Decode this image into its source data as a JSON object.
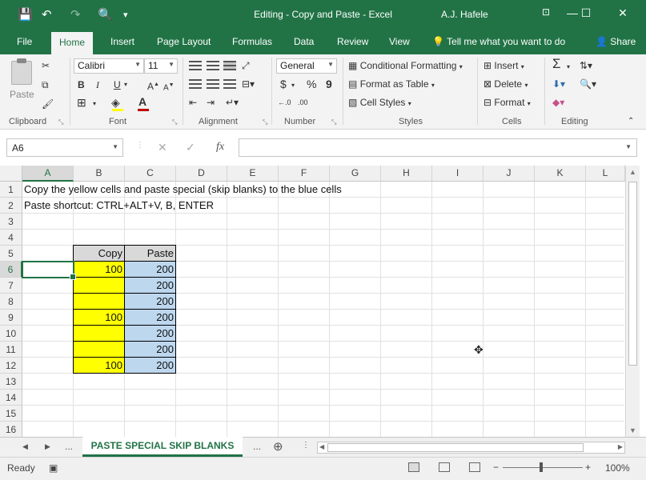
{
  "window": {
    "title": "Editing - Copy and Paste  -  Excel",
    "user": "A.J. Hafele",
    "minimize": "—",
    "maximize": "☐",
    "close": "✕",
    "ribbon_toggle": "⊡"
  },
  "qat": {
    "save": "💾",
    "undo": "↶",
    "redo": "↷",
    "preview": "🔍",
    "customize": "▾"
  },
  "tabs": [
    "File",
    "Home",
    "Insert",
    "Page Layout",
    "Formulas",
    "Data",
    "Review",
    "View"
  ],
  "active_tab": "Home",
  "tell_me": "Tell me what you want to do",
  "share": "Share",
  "ribbon": {
    "clipboard": {
      "label": "Clipboard",
      "paste": "Paste"
    },
    "font": {
      "label": "Font",
      "name": "Calibri",
      "size": "11",
      "bold": "B",
      "italic": "I",
      "underline": "U",
      "grow": "A",
      "shrink": "A"
    },
    "alignment": {
      "label": "Alignment"
    },
    "number": {
      "label": "Number",
      "format": "General",
      "currency": "$",
      "percent": "%",
      "comma": "9",
      "inc_decimal": "←.0",
      "dec_decimal": ".00"
    },
    "styles": {
      "label": "Styles",
      "conditional": "Conditional Formatting",
      "format_table": "Format as Table",
      "cell_styles": "Cell Styles"
    },
    "cells": {
      "label": "Cells",
      "insert": "Insert",
      "delete": "Delete",
      "format": "Format"
    },
    "editing": {
      "label": "Editing",
      "sum": "Σ"
    }
  },
  "formula_bar": {
    "name_box": "A6",
    "cancel": "✕",
    "enter": "✓",
    "fx": "fx",
    "value": ""
  },
  "columns": [
    "A",
    "B",
    "C",
    "D",
    "E",
    "F",
    "G",
    "H",
    "I",
    "J",
    "K",
    "L"
  ],
  "selected_column": "A",
  "rows": [
    "1",
    "2",
    "3",
    "4",
    "5",
    "6",
    "7",
    "8",
    "9",
    "10",
    "11",
    "12",
    "13",
    "14",
    "15",
    "16"
  ],
  "selected_row": "6",
  "sheet": {
    "a1": "Copy the yellow cells and paste special (skip blanks) to the blue cells",
    "a2": "Paste shortcut: CTRL+ALT+V, B, ENTER",
    "copy_header": "Copy",
    "paste_header": "Paste",
    "copy_values": [
      "100",
      "",
      "",
      "100",
      "",
      "",
      "100"
    ],
    "paste_values": [
      "200",
      "200",
      "200",
      "200",
      "200",
      "200",
      "200"
    ]
  },
  "colors": {
    "excel_green": "#217346",
    "copy_fill": "#ffff00",
    "paste_fill": "#bdd7ee",
    "header_fill": "#d9d9d9"
  },
  "sheet_tabs": {
    "nav_prev": "◀",
    "nav_next": "▶",
    "more_left": "...",
    "active": "PASTE SPECIAL SKIP BLANKS",
    "more_right": "...",
    "add": "⊕"
  },
  "status": {
    "ready": "Ready",
    "zoom": "100%",
    "zoom_out": "−",
    "zoom_in": "+"
  }
}
